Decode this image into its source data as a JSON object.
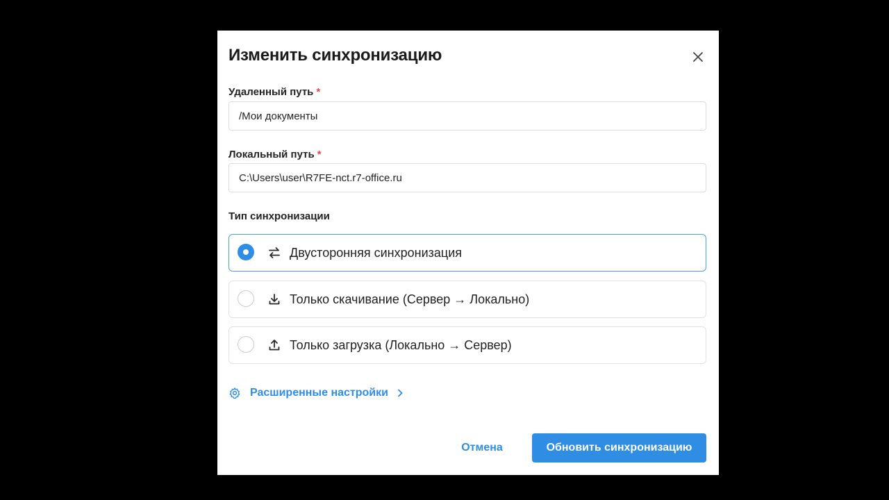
{
  "dialog": {
    "title": "Изменить синхронизацию",
    "close_icon": "close-icon"
  },
  "fields": {
    "remote": {
      "label": "Удаленный путь",
      "required_mark": "*",
      "value": "/Мои документы"
    },
    "local": {
      "label": "Локальный путь",
      "required_mark": "*",
      "value": "C:\\Users\\user\\R7FE-nct.r7-office.ru"
    }
  },
  "sync_type": {
    "label": "Тип синхронизации",
    "selected": 0,
    "options": [
      {
        "label": "Двусторонняя синхронизация",
        "icon": "swap-arrows-icon"
      },
      {
        "label": "Только скачивание (Сервер → Локально)",
        "icon": "download-icon"
      },
      {
        "label": "Только загрузка (Локально → Сервер)",
        "icon": "upload-icon"
      }
    ]
  },
  "advanced": {
    "label": "Расширенные настройки",
    "icon": "gear-icon",
    "chevron": "chevron-right-icon"
  },
  "actions": {
    "cancel_label": "Отмена",
    "submit_label": "Обновить синхронизацию"
  },
  "colors": {
    "accent": "#2f8de4",
    "required": "#e5484d",
    "backdrop": "#000000"
  }
}
